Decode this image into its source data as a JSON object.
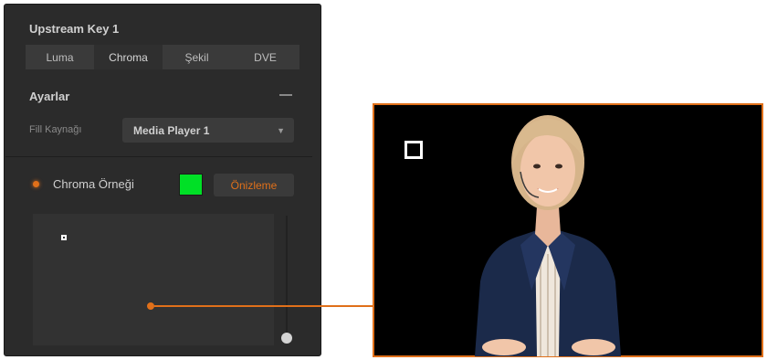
{
  "panel": {
    "title": "Upstream Key 1",
    "tabs": [
      {
        "label": "Luma"
      },
      {
        "label": "Chroma"
      },
      {
        "label": "Şekil"
      },
      {
        "label": "DVE"
      }
    ],
    "active_tab": "Chroma",
    "section_title": "Ayarlar",
    "fill_source_label": "Fill Kaynağı",
    "fill_source_value": "Media Player 1",
    "chroma_sample_label": "Chroma Örneği",
    "chroma_sample_color": "#00e026",
    "preview_button_label": "Önizleme",
    "accent_color": "#e0701a"
  },
  "icons": {
    "collapse": "minus-icon",
    "dropdown": "chevron-down-icon",
    "sample_marker": "square-marker-icon"
  },
  "preview": {
    "description_icon": "square-marker-icon"
  }
}
